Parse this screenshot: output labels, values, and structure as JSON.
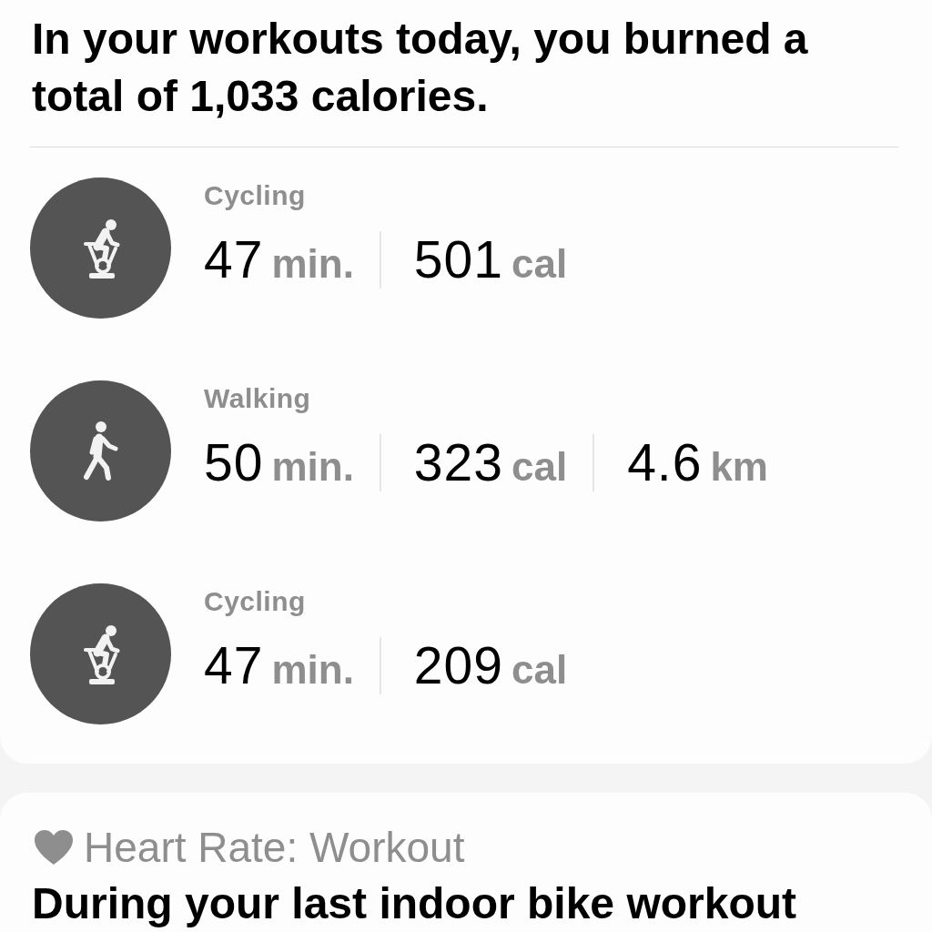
{
  "summary": "In your workouts today, you burned a total of 1,033 calories.",
  "workouts": [
    {
      "kind": "cycling",
      "name": "Cycling",
      "metrics": [
        {
          "value": "47",
          "unit": "min."
        },
        {
          "value": "501",
          "unit": "cal"
        }
      ]
    },
    {
      "kind": "walking",
      "name": "Walking",
      "metrics": [
        {
          "value": "50",
          "unit": "min."
        },
        {
          "value": "323",
          "unit": "cal"
        },
        {
          "value": "4.6",
          "unit": "km"
        }
      ]
    },
    {
      "kind": "cycling",
      "name": "Cycling",
      "metrics": [
        {
          "value": "47",
          "unit": "min."
        },
        {
          "value": "209",
          "unit": "cal"
        }
      ]
    }
  ],
  "heart_rate": {
    "title": "Heart Rate: Workout",
    "text": "During your last indoor bike workout"
  }
}
